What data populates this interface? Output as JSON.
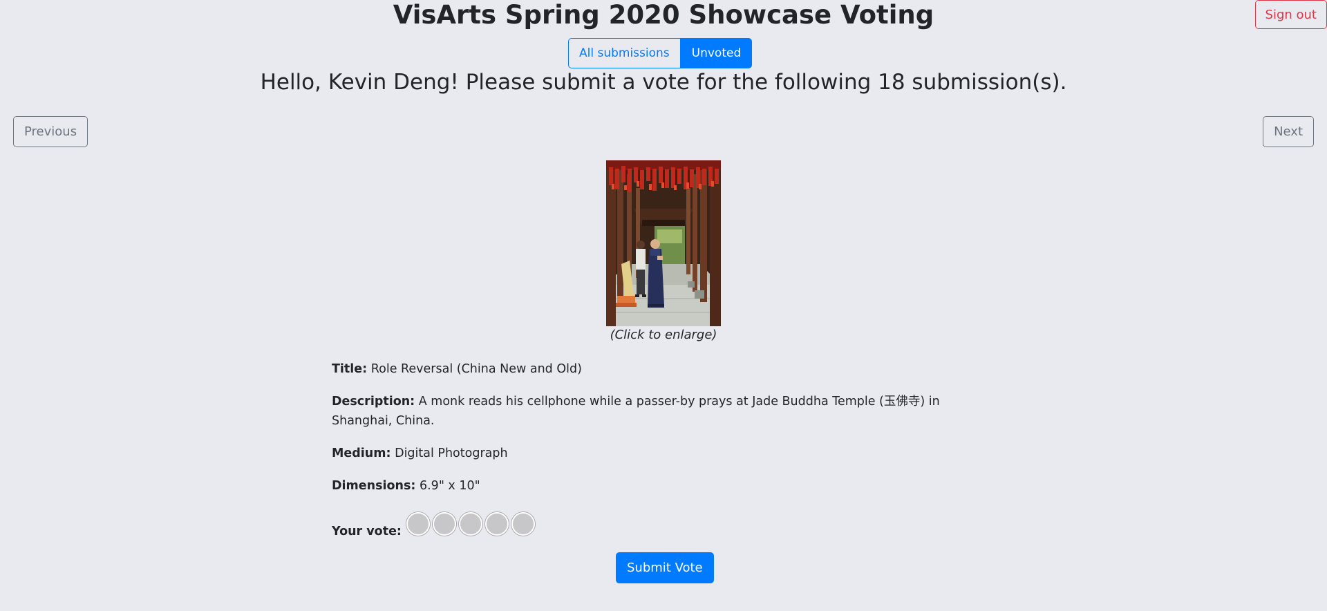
{
  "page": {
    "title": "VisArts Spring 2020 Showcase Voting",
    "sign_out_label": "Sign out",
    "greeting": "Hello, Kevin Deng! Please submit a vote for the following 18 submission(s)."
  },
  "filter": {
    "all_label": "All submissions",
    "unvoted_label": "Unvoted",
    "selected": "Unvoted"
  },
  "nav": {
    "previous_label": "Previous",
    "next_label": "Next"
  },
  "submission": {
    "image_caption": "(Click to enlarge)",
    "title_label": "Title:",
    "title": "Role Reversal (China New and Old)",
    "description_label": "Description:",
    "description": "A monk reads his cellphone while a passer-by prays at Jade Buddha Temple (玉佛寺) in Shanghai, China.",
    "medium_label": "Medium:",
    "medium": "Digital Photograph",
    "dimensions_label": "Dimensions:",
    "dimensions": "6.9\" x 10\""
  },
  "vote": {
    "label": "Your vote:",
    "max_rating": 5,
    "selected_rating": 0,
    "submit_label": "Submit Vote"
  },
  "colors": {
    "background": "#e9eaf0",
    "primary": "#007bff",
    "danger": "#dc3545",
    "secondary": "#6c757d"
  }
}
